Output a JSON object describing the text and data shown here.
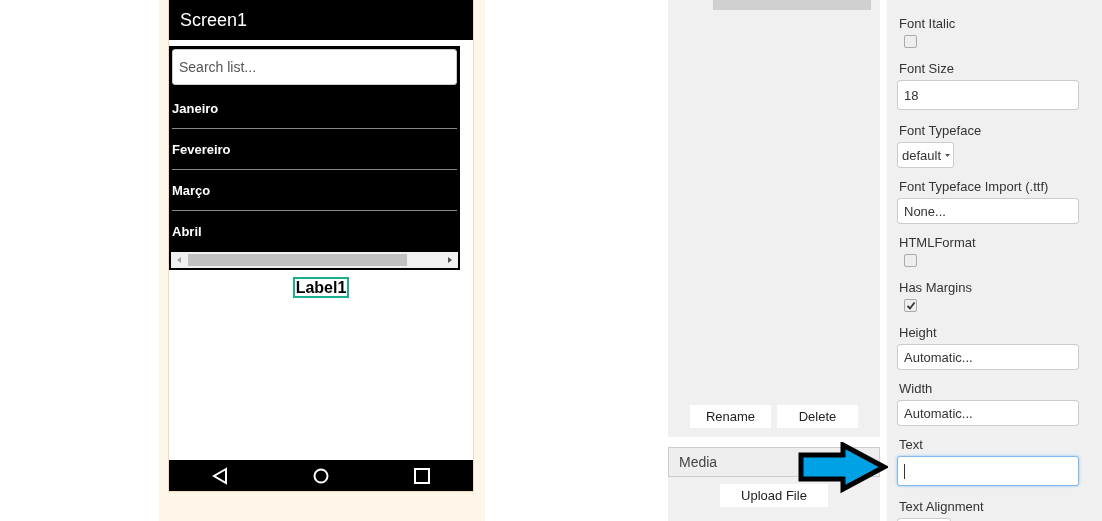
{
  "phone": {
    "title": "Screen1",
    "search": {
      "placeholder": "Search list..."
    },
    "list_items": [
      "Janeiro",
      "Fevereiro",
      "Março",
      "Abril"
    ],
    "label": {
      "text": "Label1",
      "selected": true
    }
  },
  "components": {
    "buttons": [
      "Rename",
      "Delete"
    ]
  },
  "media": {
    "title": "Media",
    "button": "Upload File"
  },
  "properties": [
    {
      "kind": "checkbox",
      "label": "Font Italic",
      "checked": false
    },
    {
      "kind": "text",
      "label": "Font Size",
      "value": "18",
      "tall": true
    },
    {
      "kind": "dropdown",
      "label": "Font Typeface",
      "value": "default"
    },
    {
      "kind": "text",
      "label": "Font Typeface Import (.ttf)",
      "value": "None..."
    },
    {
      "kind": "checkbox",
      "label": "HTMLFormat",
      "checked": false
    },
    {
      "kind": "checkbox",
      "label": "Has Margins",
      "checked": true
    },
    {
      "kind": "text",
      "label": "Height",
      "value": "Automatic..."
    },
    {
      "kind": "text",
      "label": "Width",
      "value": "Automatic..."
    },
    {
      "kind": "text",
      "label": "Text",
      "focused": true,
      "tall": true
    },
    {
      "kind": "dropdown",
      "label": "Text Alignment"
    }
  ]
}
